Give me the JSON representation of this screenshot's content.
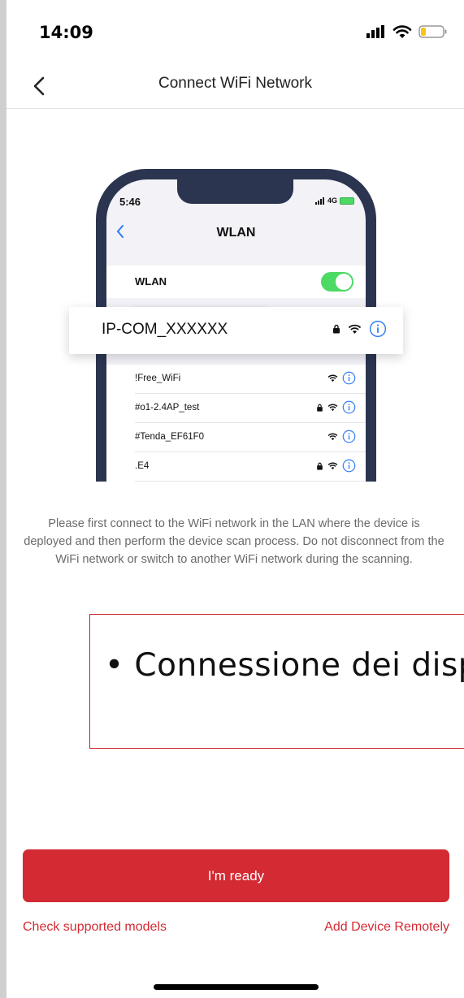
{
  "status_bar": {
    "time": "14:09"
  },
  "nav": {
    "title": "Connect WiFi Network",
    "back_icon": "chevron-left-icon"
  },
  "illustration": {
    "phone_time": "5:46",
    "phone_network": "4G",
    "screen_title": "WLAN",
    "wlan_label": "WLAN",
    "highlighted_network": "IP-COM_XXXXXX",
    "networks": [
      {
        "name": "!Free_WiFi",
        "locked": false
      },
      {
        "name": "#o1-2.4AP_test",
        "locked": true
      },
      {
        "name": "#Tenda_EF61F0",
        "locked": false
      },
      {
        "name": ".E4",
        "locked": true
      }
    ]
  },
  "instruction": "Please first connect to the WiFi network in the LAN where the device is deployed and then perform the device scan process. Do not disconnect from the WiFi network or switch to another WiFi network during the scanning.",
  "overlay_text": "• Connessione dei disp",
  "actions": {
    "ready_label": "I'm ready",
    "check_models_label": "Check supported models",
    "add_remote_label": "Add Device Remotely"
  },
  "colors": {
    "accent": "#d42a33",
    "phone_frame": "#2b3550",
    "toggle_on": "#4cd964",
    "ios_blue": "#2f7cf6"
  }
}
